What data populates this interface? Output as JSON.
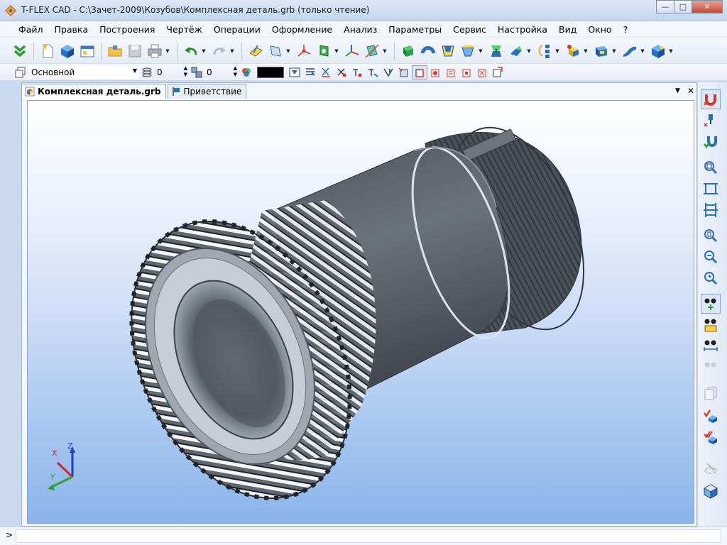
{
  "window": {
    "title": "T-FLEX CAD - C:\\Зачет-2009\\Козубов\\Комплексная деталь.grb (только чтение)",
    "minimize": "—",
    "maximize": "□",
    "close": "✕"
  },
  "menu": [
    {
      "label": "Файл"
    },
    {
      "label": "Правка"
    },
    {
      "label": "Построения"
    },
    {
      "label": "Чертёж"
    },
    {
      "label": "Операции"
    },
    {
      "label": "Оформление"
    },
    {
      "label": "Анализ"
    },
    {
      "label": "Параметры"
    },
    {
      "label": "Сервис"
    },
    {
      "label": "Настройка"
    },
    {
      "label": "Вид"
    },
    {
      "label": "Окно"
    },
    {
      "label": "?"
    }
  ],
  "toolbar2": {
    "layer": "Основной",
    "level_value": "0",
    "priority_value": "0",
    "color": "#000000"
  },
  "tabs": [
    {
      "label": "Комплексная деталь.grb",
      "active": true
    },
    {
      "label": "Приветствие",
      "active": false
    }
  ],
  "tab_controls": {
    "dropdown": "▼",
    "close": "✕"
  },
  "axes": {
    "x": "X",
    "y": "Y",
    "z": "Z"
  },
  "statusbar": {
    "prompt": ">"
  },
  "colors": {
    "accent": "#3a78c9",
    "part_body": "#5d6670",
    "gear_face": "#9aa3aa",
    "viewport_top": "#ffffff",
    "viewport_bottom": "#8ab4ea"
  }
}
